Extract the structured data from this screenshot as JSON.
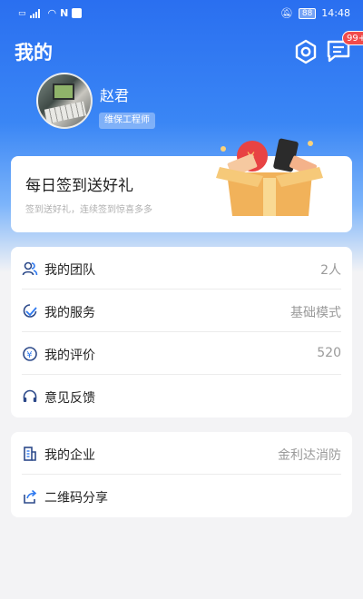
{
  "status_bar": {
    "left_icons": [
      "sim-icon",
      "signal-icon",
      "wifi-icon",
      "nfc-icon",
      "notification-icon"
    ],
    "battery": "88",
    "time": "14:48"
  },
  "header": {
    "title": "我的",
    "message_badge": "99+"
  },
  "profile": {
    "name": "赵君",
    "role": "维保工程师"
  },
  "signin": {
    "title": "每日签到送好礼",
    "subtitle": "签到送好礼，连续签到惊喜多多"
  },
  "menu": [
    {
      "icon": "team-icon",
      "label": "我的团队",
      "value": "2人"
    },
    {
      "icon": "service-icon",
      "label": "我的服务",
      "value": "基础模式"
    },
    {
      "icon": "rating-icon",
      "label": "我的评价",
      "value": "520"
    },
    {
      "icon": "headset-icon",
      "label": "意见反馈",
      "value": ""
    }
  ],
  "menu2": [
    {
      "icon": "company-icon",
      "label": "我的企业",
      "value": "金利达消防"
    },
    {
      "icon": "share-icon",
      "label": "二维码分享",
      "value": ""
    }
  ],
  "colors": {
    "primary": "#2a6ff0",
    "badge": "#f14b4b",
    "icon": "#2d4a8a"
  }
}
